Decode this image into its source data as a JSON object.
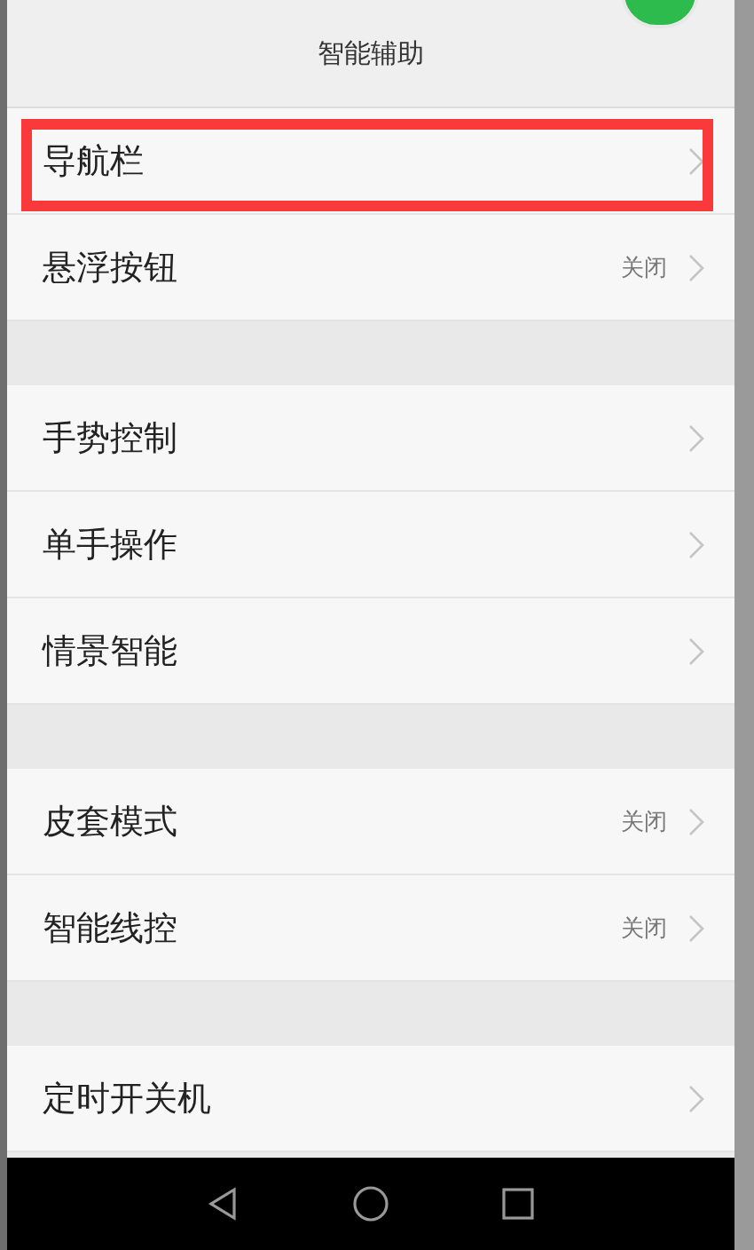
{
  "header": {
    "title": "智能辅助"
  },
  "sections": [
    {
      "items": [
        {
          "label": "导航栏",
          "highlighted": true
        },
        {
          "label": "悬浮按钮",
          "value": "关闭",
          "highlighted": false
        }
      ]
    },
    {
      "items": [
        {
          "label": "手势控制",
          "highlighted": false
        },
        {
          "label": "单手操作",
          "highlighted": false
        },
        {
          "label": "情景智能",
          "highlighted": false
        }
      ]
    },
    {
      "items": [
        {
          "label": "皮套模式",
          "value": "关闭",
          "highlighted": false
        },
        {
          "label": "智能线控",
          "value": "关闭",
          "highlighted": false
        }
      ]
    },
    {
      "items": [
        {
          "label": "定时开关机",
          "highlighted": false
        }
      ]
    }
  ]
}
